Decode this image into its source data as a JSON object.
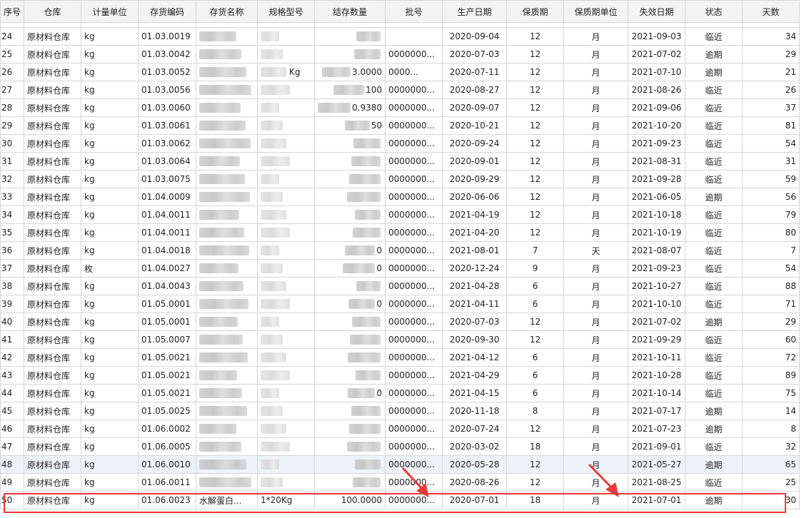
{
  "columns": [
    "序号",
    "仓库",
    "计量单位",
    "存货编码",
    "存货名称",
    "规格型号",
    "结存数量",
    "批号",
    "生产日期",
    "保质期",
    "保质期单位",
    "失效日期",
    "状态",
    "天数"
  ],
  "rows": [
    {
      "seq": "24",
      "wh": "原材料仓库",
      "unit": "kg",
      "code": "01.03.0019",
      "name": "",
      "spec": "",
      "qty": "",
      "lot": "",
      "prod": "2020-09-04",
      "shelf": "12",
      "su": "月",
      "exp": "2021-09-03",
      "status": "临近",
      "days": "34"
    },
    {
      "seq": "25",
      "wh": "原材料仓库",
      "unit": "kg",
      "code": "01.03.0042",
      "name": "",
      "spec": "",
      "qty": "",
      "lot": "0000000...",
      "prod": "2020-07-03",
      "shelf": "12",
      "su": "月",
      "exp": "2021-07-02",
      "status": "逾期",
      "days": "29"
    },
    {
      "seq": "26",
      "wh": "原材料仓库",
      "unit": "kg",
      "code": "01.03.0052",
      "name": "",
      "spec": "Kg",
      "qty": "3.0000",
      "lot": "0000...",
      "prod": "2020-07-11",
      "shelf": "12",
      "su": "月",
      "exp": "2021-07-10",
      "status": "逾期",
      "days": "21"
    },
    {
      "seq": "27",
      "wh": "原材料仓库",
      "unit": "kg",
      "code": "01.03.0056",
      "name": "",
      "spec": "",
      "qty": "100",
      "lot": "0000000...",
      "prod": "2020-08-27",
      "shelf": "12",
      "su": "月",
      "exp": "2021-08-26",
      "status": "临近",
      "days": "26"
    },
    {
      "seq": "28",
      "wh": "原材料仓库",
      "unit": "kg",
      "code": "01.03.0060",
      "name": "",
      "spec": "",
      "qty": "0.9380",
      "lot": "0000000...",
      "prod": "2020-09-07",
      "shelf": "12",
      "su": "月",
      "exp": "2021-09-06",
      "status": "临近",
      "days": "37"
    },
    {
      "seq": "29",
      "wh": "原材料仓库",
      "unit": "kg",
      "code": "01.03.0061",
      "name": "",
      "spec": "",
      "qty": "50",
      "lot": "0000000...",
      "prod": "2020-10-21",
      "shelf": "12",
      "su": "月",
      "exp": "2021-10-20",
      "status": "临近",
      "days": "81"
    },
    {
      "seq": "30",
      "wh": "原材料仓库",
      "unit": "kg",
      "code": "01.03.0062",
      "name": "",
      "spec": "",
      "qty": "",
      "lot": "0000000...",
      "prod": "2020-09-24",
      "shelf": "12",
      "su": "月",
      "exp": "2021-09-23",
      "status": "临近",
      "days": "54"
    },
    {
      "seq": "31",
      "wh": "原材料仓库",
      "unit": "kg",
      "code": "01.03.0064",
      "name": "",
      "spec": "",
      "qty": "",
      "lot": "0000000...",
      "prod": "2020-09-01",
      "shelf": "12",
      "su": "月",
      "exp": "2021-08-31",
      "status": "临近",
      "days": "31"
    },
    {
      "seq": "32",
      "wh": "原材料仓库",
      "unit": "kg",
      "code": "01.03.0075",
      "name": "",
      "spec": "",
      "qty": "",
      "lot": "0000000...",
      "prod": "2020-09-29",
      "shelf": "12",
      "su": "月",
      "exp": "2021-09-28",
      "status": "临近",
      "days": "59"
    },
    {
      "seq": "33",
      "wh": "原材料仓库",
      "unit": "kg",
      "code": "01.04.0009",
      "name": "",
      "spec": "",
      "qty": "",
      "lot": "0000000...",
      "prod": "2020-06-06",
      "shelf": "12",
      "su": "月",
      "exp": "2021-06-05",
      "status": "逾期",
      "days": "56"
    },
    {
      "seq": "34",
      "wh": "原材料仓库",
      "unit": "kg",
      "code": "01.04.0011",
      "name": "",
      "spec": "",
      "qty": "",
      "lot": "0000000...",
      "prod": "2021-04-19",
      "shelf": "12",
      "su": "月",
      "exp": "2021-10-18",
      "status": "临近",
      "days": "79"
    },
    {
      "seq": "35",
      "wh": "原材料仓库",
      "unit": "kg",
      "code": "01.04.0011",
      "name": "",
      "spec": "",
      "qty": "",
      "lot": "0000000...",
      "prod": "2021-04-20",
      "shelf": "12",
      "su": "月",
      "exp": "2021-10-19",
      "status": "临近",
      "days": "80"
    },
    {
      "seq": "36",
      "wh": "原材料仓库",
      "unit": "kg",
      "code": "01.04.0018",
      "name": "",
      "spec": "",
      "qty": "0",
      "lot": "0000000...",
      "prod": "2021-08-01",
      "shelf": "7",
      "su": "天",
      "exp": "2021-08-07",
      "status": "临近",
      "days": "7"
    },
    {
      "seq": "37",
      "wh": "原材料仓库",
      "unit": "枚",
      "code": "01.04.0027",
      "name": "",
      "spec": "",
      "qty": "0",
      "lot": "0000000...",
      "prod": "2020-12-24",
      "shelf": "9",
      "su": "月",
      "exp": "2021-09-23",
      "status": "临近",
      "days": "54"
    },
    {
      "seq": "38",
      "wh": "原材料仓库",
      "unit": "kg",
      "code": "01.04.0043",
      "name": "",
      "spec": "",
      "qty": "",
      "lot": "0000000...",
      "prod": "2021-04-28",
      "shelf": "6",
      "su": "月",
      "exp": "2021-10-27",
      "status": "临近",
      "days": "88"
    },
    {
      "seq": "39",
      "wh": "原材料仓库",
      "unit": "kg",
      "code": "01.05.0001",
      "name": "",
      "spec": "",
      "qty": "0",
      "lot": "0000000...",
      "prod": "2021-04-11",
      "shelf": "6",
      "su": "月",
      "exp": "2021-10-10",
      "status": "临近",
      "days": "71"
    },
    {
      "seq": "40",
      "wh": "原材料仓库",
      "unit": "kg",
      "code": "01.05.0001",
      "name": "",
      "spec": "",
      "qty": "",
      "lot": "0000000...",
      "prod": "2020-07-03",
      "shelf": "12",
      "su": "月",
      "exp": "2021-07-02",
      "status": "逾期",
      "days": "29"
    },
    {
      "seq": "41",
      "wh": "原材料仓库",
      "unit": "kg",
      "code": "01.05.0007",
      "name": "",
      "spec": "",
      "qty": "",
      "lot": "0000000...",
      "prod": "2020-09-30",
      "shelf": "12",
      "su": "月",
      "exp": "2021-09-29",
      "status": "临近",
      "days": "60"
    },
    {
      "seq": "42",
      "wh": "原材料仓库",
      "unit": "kg",
      "code": "01.05.0021",
      "name": "",
      "spec": "",
      "qty": "",
      "lot": "0000000...",
      "prod": "2021-04-12",
      "shelf": "6",
      "su": "月",
      "exp": "2021-10-11",
      "status": "临近",
      "days": "72"
    },
    {
      "seq": "43",
      "wh": "原材料仓库",
      "unit": "kg",
      "code": "01.05.0021",
      "name": "",
      "spec": "",
      "qty": "",
      "lot": "0000000...",
      "prod": "2021-04-29",
      "shelf": "6",
      "su": "月",
      "exp": "2021-10-28",
      "status": "临近",
      "days": "89"
    },
    {
      "seq": "44",
      "wh": "原材料仓库",
      "unit": "kg",
      "code": "01.05.0021",
      "name": "",
      "spec": "",
      "qty": "0",
      "lot": "0000000...",
      "prod": "2021-04-15",
      "shelf": "6",
      "su": "月",
      "exp": "2021-10-14",
      "status": "临近",
      "days": "75"
    },
    {
      "seq": "45",
      "wh": "原材料仓库",
      "unit": "kg",
      "code": "01.05.0025",
      "name": "",
      "spec": "",
      "qty": "",
      "lot": "0000000...",
      "prod": "2020-11-18",
      "shelf": "8",
      "su": "月",
      "exp": "2021-07-17",
      "status": "逾期",
      "days": "14"
    },
    {
      "seq": "46",
      "wh": "原材料仓库",
      "unit": "kg",
      "code": "01.06.0002",
      "name": "",
      "spec": "",
      "qty": "",
      "lot": "0000000...",
      "prod": "2020-07-24",
      "shelf": "12",
      "su": "月",
      "exp": "2021-07-23",
      "status": "逾期",
      "days": "8"
    },
    {
      "seq": "47",
      "wh": "原材料仓库",
      "unit": "kg",
      "code": "01.06.0005",
      "name": "",
      "spec": "",
      "qty": "",
      "lot": "0000000...",
      "prod": "2020-03-02",
      "shelf": "18",
      "su": "月",
      "exp": "2021-09-01",
      "status": "临近",
      "days": "32"
    },
    {
      "seq": "48",
      "wh": "原材料仓库",
      "unit": "kg",
      "code": "01.06.0010",
      "name": "",
      "spec": "",
      "qty": "",
      "lot": "0000000...",
      "prod": "2020-05-28",
      "shelf": "12",
      "su": "月",
      "exp": "2021-05-27",
      "status": "逾期",
      "days": "65"
    },
    {
      "seq": "49",
      "wh": "原材料仓库",
      "unit": "kg",
      "code": "01.06.0011",
      "name": "",
      "spec": "",
      "qty": "",
      "lot": "0000000...",
      "prod": "2020-08-26",
      "shelf": "12",
      "su": "月",
      "exp": "2021-08-25",
      "status": "临近",
      "days": "25"
    },
    {
      "seq": "50",
      "wh": "原材料仓库",
      "unit": "kg",
      "code": "01.06.0023",
      "name": "水解蛋白...",
      "spec": "1*20Kg",
      "qty": "100.0000",
      "lot": "0000000...",
      "prod": "2020-07-01",
      "shelf": "18",
      "su": "月",
      "exp": "2021-07-01",
      "status": "逾期",
      "days": "30"
    }
  ],
  "selected_row": "48",
  "highlighted_row": "50",
  "colors": {
    "highlight": "#e83a3a",
    "selected_row_bg": "#eef2fb",
    "header_bg": "#f3f3f3",
    "grid_line": "#d6d6d6"
  }
}
